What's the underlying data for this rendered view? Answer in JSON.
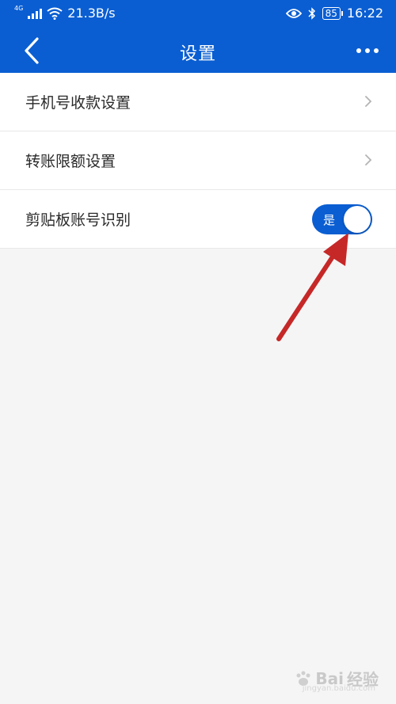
{
  "status_bar": {
    "network_tag": "4G",
    "speed": "21.3B/s",
    "battery": "85",
    "time": "16:22"
  },
  "header": {
    "title": "设置",
    "back_icon": "back-chevron-icon",
    "more_icon": "more-dots-icon"
  },
  "settings": {
    "items": [
      {
        "label": "手机号收款设置",
        "type": "link"
      },
      {
        "label": "转账限额设置",
        "type": "link"
      },
      {
        "label": "剪贴板账号识别",
        "type": "toggle",
        "toggle_text": "是",
        "on": true
      }
    ]
  },
  "watermark": {
    "text": "Bai",
    "suffix": "经验",
    "url": "jingyan.baidu.com"
  },
  "colors": {
    "primary": "#0a5ed2",
    "background": "#f5f5f5",
    "annotation_arrow": "#c62828"
  }
}
